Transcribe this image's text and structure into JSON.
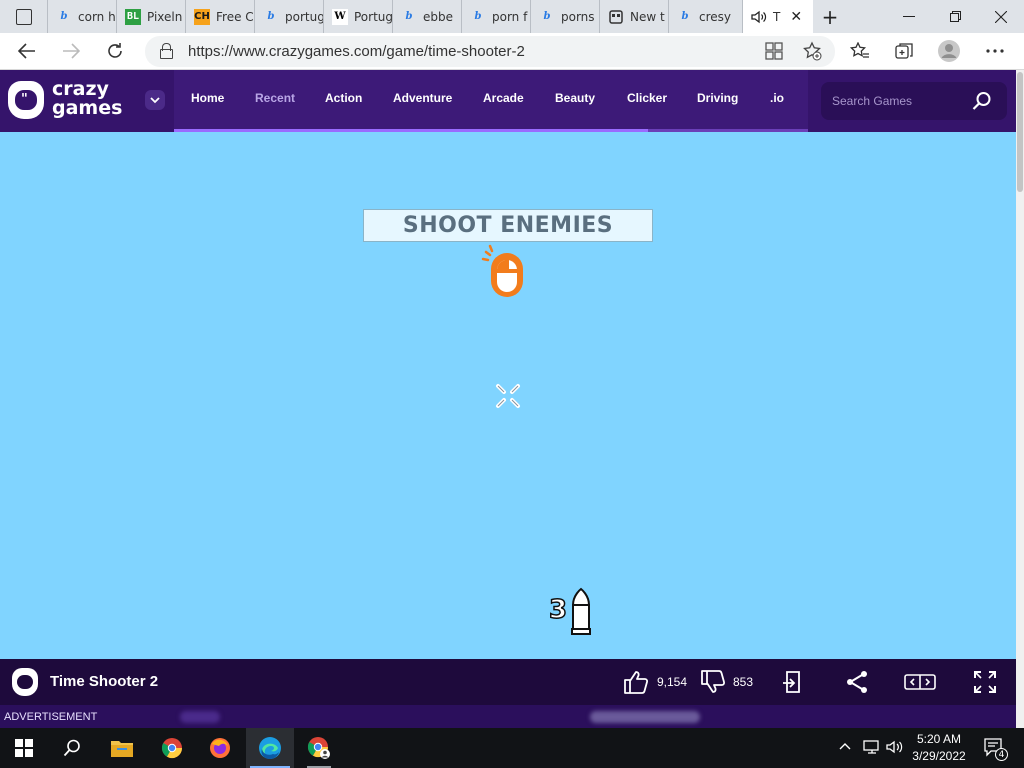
{
  "browser": {
    "tabs": [
      {
        "label": "",
        "icon": "tab-actions-icon"
      },
      {
        "label": "corn h",
        "icon": "bing-icon"
      },
      {
        "label": "Pixeln",
        "icon": "bl-icon"
      },
      {
        "label": "Free C",
        "icon": "ch-icon"
      },
      {
        "label": "portug",
        "icon": "bing-icon"
      },
      {
        "label": "Portug",
        "icon": "wikipedia-icon"
      },
      {
        "label": "ebbe",
        "icon": "bing-icon"
      },
      {
        "label": "porn f",
        "icon": "bing-icon"
      },
      {
        "label": "porns",
        "icon": "bing-icon"
      },
      {
        "label": "New t",
        "icon": "new-tab-icon"
      },
      {
        "label": "cresy",
        "icon": "bing-icon"
      },
      {
        "label": "T",
        "icon": "speaker-icon",
        "active": true
      }
    ],
    "new_tab_symbol": "+",
    "url": "https://www.crazygames.com/game/time-shooter-2"
  },
  "site": {
    "logo_line1": "crazy",
    "logo_line2": "games",
    "nav_links": [
      "Home",
      "Recent",
      "Action",
      "Adventure",
      "Arcade",
      "Beauty",
      "Clicker",
      "Driving",
      ".io"
    ],
    "search_placeholder": "Search Games"
  },
  "game": {
    "instruction": "SHOOT ENEMIES",
    "ammo": "3",
    "title": "Time Shooter 2",
    "likes": "9,154",
    "dislikes": "853",
    "advertisement_label": "ADVERTISEMENT"
  },
  "taskbar": {
    "time": "5:20 AM",
    "date": "3/29/2022",
    "notification_count": "4"
  },
  "colors": {
    "game_background": "#80d4ff",
    "site_nav": "#35146b",
    "accent_orange": "#f27c1c"
  }
}
